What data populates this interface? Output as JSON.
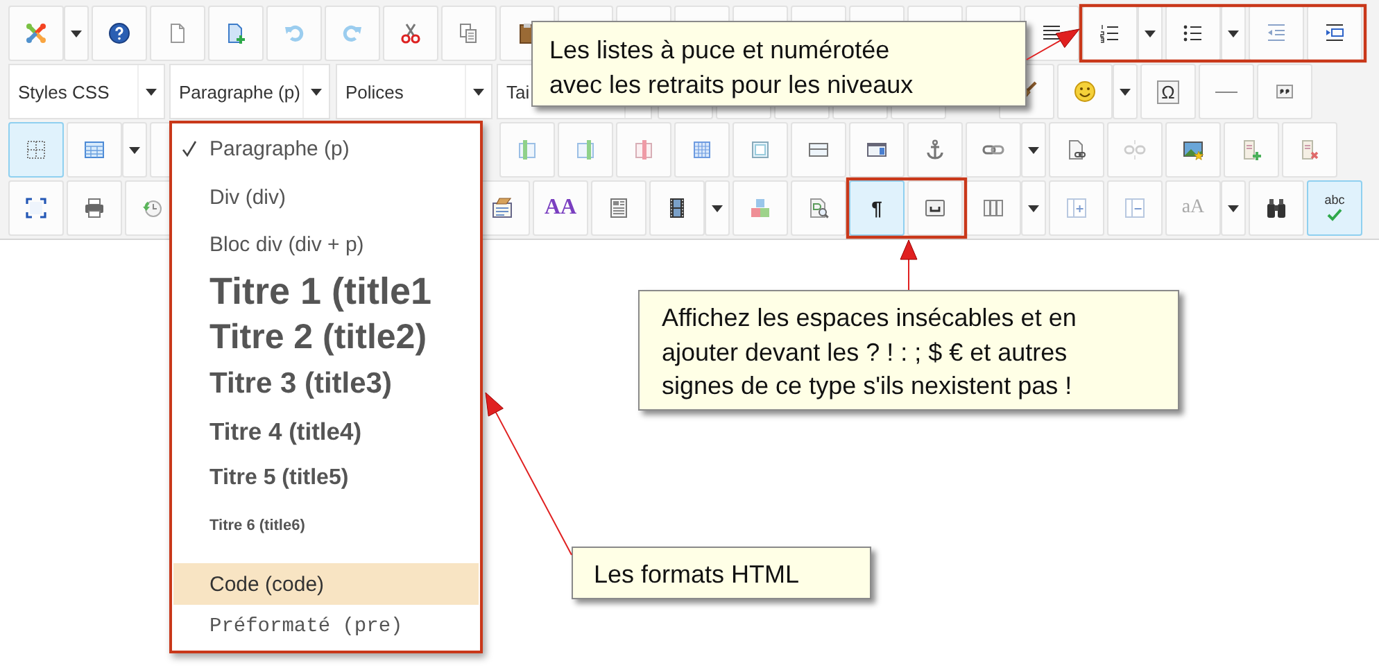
{
  "toolbar": {
    "rows": [
      [
        {
          "kind": "button",
          "active": false
        },
        {
          "kind": "caret"
        },
        {
          "kind": "button",
          "active": false
        },
        {
          "kind": "button",
          "active": false
        },
        {
          "kind": "button",
          "active": false
        },
        {
          "kind": "button",
          "active": false
        },
        {
          "kind": "button",
          "active": false
        },
        {
          "kind": "button",
          "active": false
        },
        {
          "kind": "button",
          "active": false
        },
        {
          "kind": "button",
          "active": false
        },
        {
          "kind": "button",
          "active": false
        },
        {
          "kind": "button",
          "active": false
        },
        {
          "kind": "button",
          "active": false
        },
        {
          "kind": "button",
          "active": false
        },
        {
          "kind": "button",
          "active": false
        },
        {
          "kind": "button",
          "active": false
        },
        {
          "kind": "button",
          "active": false
        },
        {
          "kind": "button",
          "active": false
        },
        {
          "kind": "button",
          "active": false
        },
        {
          "kind": "button",
          "active": false
        },
        {
          "kind": "caret"
        },
        {
          "kind": "button",
          "active": false
        },
        {
          "kind": "caret"
        },
        {
          "kind": "button",
          "active": false
        },
        {
          "kind": "button",
          "active": false
        }
      ],
      [
        {
          "kind": "select",
          "label": "Styles CSS"
        },
        {
          "kind": "select",
          "label": "Paragraphe (p)"
        },
        {
          "kind": "select",
          "label": "Polices"
        },
        {
          "kind": "select",
          "label": "Tai"
        },
        {
          "kind": "button",
          "active": false
        },
        {
          "kind": "button",
          "active": false
        },
        {
          "kind": "button",
          "active": false
        },
        {
          "kind": "button",
          "active": false
        },
        {
          "kind": "button",
          "active": false
        },
        {
          "kind": "button",
          "active": false
        },
        {
          "kind": "button",
          "active": false
        },
        {
          "kind": "caret"
        },
        {
          "kind": "button",
          "glyph": "Ω",
          "active": false
        },
        {
          "kind": "button",
          "active": false
        },
        {
          "kind": "button",
          "active": false
        }
      ],
      [
        {
          "kind": "button",
          "active": true
        },
        {
          "kind": "button",
          "active": false
        },
        {
          "kind": "caret"
        },
        {
          "kind": "button",
          "active": false
        },
        {
          "kind": "button",
          "active": false
        },
        {
          "kind": "button",
          "active": false
        },
        {
          "kind": "button",
          "active": false
        },
        {
          "kind": "button",
          "active": false
        },
        {
          "kind": "button",
          "active": false
        },
        {
          "kind": "button",
          "active": false
        },
        {
          "kind": "button",
          "active": false
        },
        {
          "kind": "button",
          "active": false
        },
        {
          "kind": "button",
          "active": false
        },
        {
          "kind": "caret"
        },
        {
          "kind": "button",
          "active": false
        },
        {
          "kind": "button",
          "active": false
        },
        {
          "kind": "button",
          "active": false
        },
        {
          "kind": "button",
          "active": false
        },
        {
          "kind": "button",
          "active": false
        }
      ],
      [
        {
          "kind": "button",
          "active": false
        },
        {
          "kind": "button",
          "active": false
        },
        {
          "kind": "button",
          "active": false
        },
        {
          "kind": "button",
          "active": false
        },
        {
          "kind": "button",
          "glyph": "AA",
          "active": false
        },
        {
          "kind": "button",
          "active": false
        },
        {
          "kind": "button",
          "active": false
        },
        {
          "kind": "caret"
        },
        {
          "kind": "button",
          "active": false
        },
        {
          "kind": "button",
          "active": false
        },
        {
          "kind": "button",
          "glyph": "¶",
          "active": true
        },
        {
          "kind": "button",
          "active": false
        },
        {
          "kind": "button",
          "active": false
        },
        {
          "kind": "caret"
        },
        {
          "kind": "button",
          "active": false
        },
        {
          "kind": "button",
          "active": false
        },
        {
          "kind": "button",
          "glyph": "aA",
          "active": false
        },
        {
          "kind": "caret"
        },
        {
          "kind": "button",
          "active": false
        },
        {
          "kind": "button",
          "glyph": "abc",
          "active": true
        }
      ]
    ]
  },
  "format_menu": {
    "items": [
      {
        "label": "Paragraphe (p)",
        "kind": "p",
        "selected": true,
        "hovered": false
      },
      {
        "label": "Div (div)",
        "kind": "div",
        "selected": false,
        "hovered": false
      },
      {
        "label": "Bloc div (div + p)",
        "kind": "div",
        "selected": false,
        "hovered": false
      },
      {
        "label": "Titre 1 (title1",
        "kind": "h1",
        "selected": false,
        "hovered": false
      },
      {
        "label": "Titre 2 (title2)",
        "kind": "h2",
        "selected": false,
        "hovered": false
      },
      {
        "label": "Titre 3 (title3)",
        "kind": "h3",
        "selected": false,
        "hovered": false
      },
      {
        "label": "Titre 4 (title4)",
        "kind": "h4",
        "selected": false,
        "hovered": false
      },
      {
        "label": "Titre 5 (title5)",
        "kind": "h5",
        "selected": false,
        "hovered": false
      },
      {
        "label": "Titre 6 (title6)",
        "kind": "h6",
        "selected": false,
        "hovered": false
      },
      {
        "label": "Code (code)",
        "kind": "code",
        "selected": false,
        "hovered": true
      },
      {
        "label": "Préformaté (pre)",
        "kind": "pre",
        "selected": false,
        "hovered": false
      }
    ]
  },
  "callouts": [
    {
      "text": "Les listes à puce et numérotée\navec les retraits pour les niveaux"
    },
    {
      "text": "Affichez les espaces insécables et en\najouter devant les ? ! : ; $ € et autres\nsignes de ce type s'ils nexistent pas !"
    },
    {
      "text": "Les formats HTML"
    }
  ]
}
